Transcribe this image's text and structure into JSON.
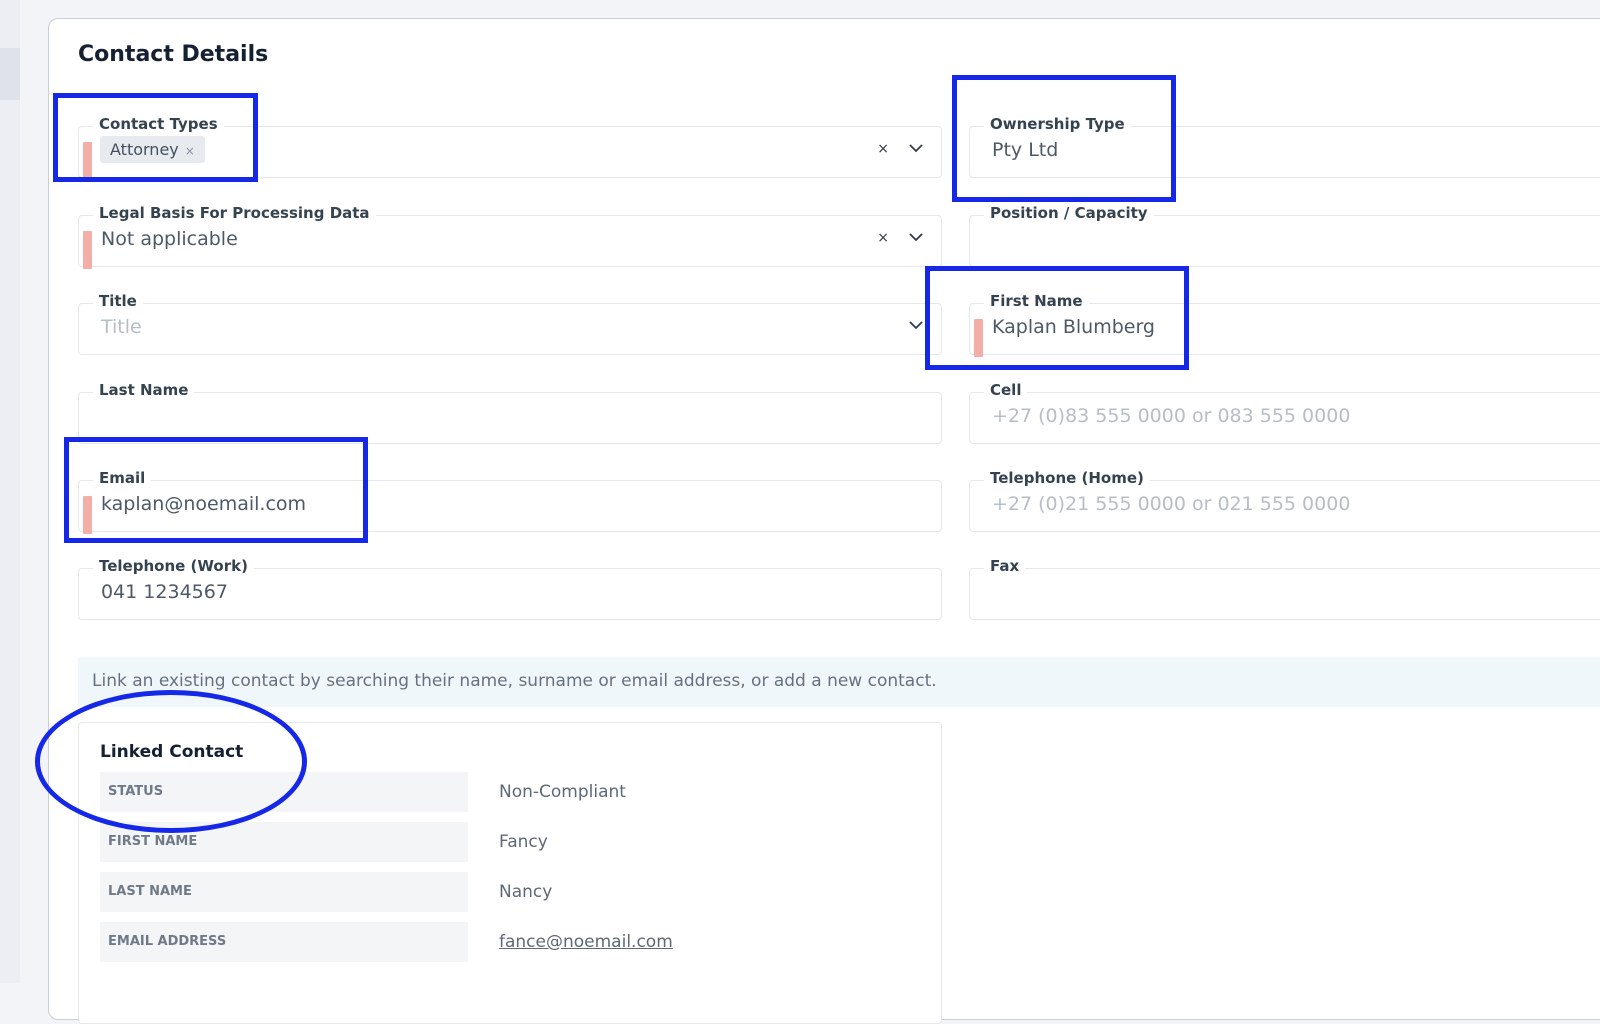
{
  "page": {
    "title": "Contact Details"
  },
  "fields": {
    "contact_types": {
      "label": "Contact Types",
      "tag": "Attorney",
      "tag_remove": "×",
      "clear": "×"
    },
    "ownership_type": {
      "label": "Ownership Type",
      "value": "Pty Ltd"
    },
    "legal_basis": {
      "label": "Legal Basis For Processing Data",
      "value": "Not applicable",
      "clear": "×"
    },
    "position": {
      "label": "Position / Capacity",
      "value": ""
    },
    "title": {
      "label": "Title",
      "placeholder": "Title"
    },
    "first_name": {
      "label": "First Name",
      "value": "Kaplan Blumberg"
    },
    "last_name": {
      "label": "Last Name",
      "value": ""
    },
    "cell": {
      "label": "Cell",
      "placeholder": "+27 (0)83 555 0000 or 083 555 0000"
    },
    "email": {
      "label": "Email",
      "value": "kaplan@noemail.com"
    },
    "tel_home": {
      "label": "Telephone (Home)",
      "placeholder": "+27 (0)21 555 0000 or 021 555 0000"
    },
    "tel_work": {
      "label": "Telephone (Work)",
      "value": "041 1234567"
    },
    "fax": {
      "label": "Fax",
      "value": ""
    }
  },
  "info": {
    "text": "Link an existing contact by searching their name, surname or email address, or add a new contact."
  },
  "linked_contact": {
    "title": "Linked Contact",
    "rows": [
      {
        "key": "STATUS",
        "value": "Non-Compliant"
      },
      {
        "key": "FIRST NAME",
        "value": "Fancy"
      },
      {
        "key": "LAST NAME",
        "value": "Nancy"
      },
      {
        "key": "EMAIL ADDRESS",
        "value": "fance@noemail.com"
      }
    ]
  },
  "colors": {
    "required_marker": "#f4aea8",
    "highlight": "#1528e8",
    "info_bg": "#f0f7fb"
  },
  "icons": {
    "dropdown": "chevron-down-icon",
    "clear": "clear-icon"
  }
}
